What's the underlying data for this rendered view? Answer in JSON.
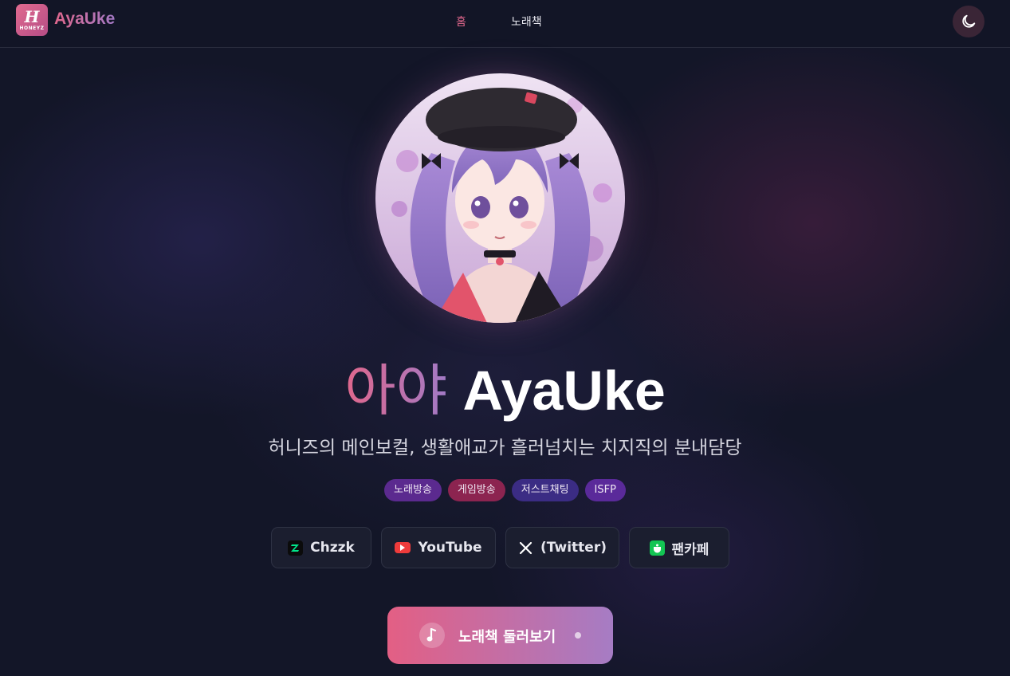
{
  "nav": {
    "logo_mark": "H",
    "logo_sub": "HONEYZ",
    "brand": "AyaUke",
    "links": [
      {
        "label": "홈",
        "active": true
      },
      {
        "label": "노래책",
        "active": false
      }
    ],
    "theme_icon": "moon-icon"
  },
  "hero": {
    "title_korean": "아야",
    "title_english": "AyaUke",
    "subtitle": "허니즈의 메인보컬, 생활애교가 흘러넘치는 치지직의 분내담당",
    "tags": [
      {
        "label": "노래방송",
        "color": "#5b2a8f"
      },
      {
        "label": "게임방송",
        "color": "#8c2450"
      },
      {
        "label": "저스트채팅",
        "color": "#3b2c84"
      },
      {
        "label": "ISFP",
        "color": "#5a2a9a"
      }
    ],
    "links": [
      {
        "label": "Chzzk",
        "icon": "chzzk-icon",
        "color": "#00e58a"
      },
      {
        "label": "YouTube",
        "icon": "youtube-icon",
        "color": "#ef3b3b"
      },
      {
        "label": "(Twitter)",
        "icon": "x-icon",
        "color": "#ffffff"
      },
      {
        "label": "팬카페",
        "icon": "fancafe-icon",
        "color": "#13c553"
      }
    ],
    "cta": {
      "label": "노래책 둘러보기",
      "icon": "music-note-icon"
    }
  },
  "colors": {
    "accent_pink": "#e0678c",
    "accent_purple": "#a67cc4",
    "background": "#131628"
  }
}
